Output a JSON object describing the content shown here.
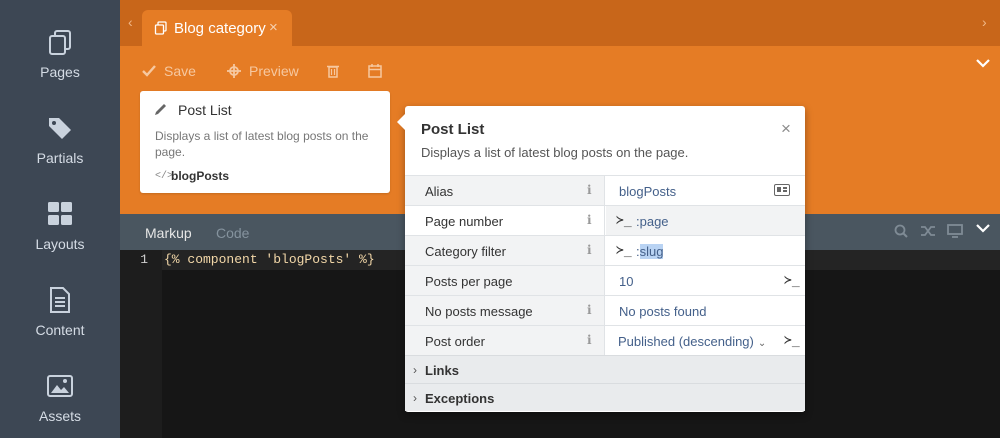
{
  "sidebar": {
    "items": [
      {
        "label": "Pages",
        "icon": "pages-icon"
      },
      {
        "label": "Partials",
        "icon": "partials-icon"
      },
      {
        "label": "Layouts",
        "icon": "layouts-icon"
      },
      {
        "label": "Content",
        "icon": "content-icon"
      },
      {
        "label": "Assets",
        "icon": "assets-icon"
      }
    ]
  },
  "header": {
    "tab": {
      "label": "Blog category",
      "close": "×"
    },
    "nav_left": "‹",
    "nav_right": "›",
    "toolbar": {
      "save_label": "Save",
      "preview_label": "Preview"
    },
    "collapse_icon": "⌄"
  },
  "component_card": {
    "title": "Post List",
    "description": "Displays a list of latest blog posts on the page.",
    "code_icon": "</>",
    "alias": "blogPosts"
  },
  "editor": {
    "tabs": [
      "Markup",
      "Code"
    ],
    "line_number": "1",
    "code": "{% component 'blogPosts' %}"
  },
  "inspector": {
    "title": "Post List",
    "description": "Displays a list of latest blog posts on the page.",
    "close": "×",
    "info_glyph": "i",
    "prompt_glyph": "≻_",
    "properties": [
      {
        "label": "Alias",
        "value": "blogPosts"
      },
      {
        "label": "Page number",
        "value": ":page"
      },
      {
        "label": "Category filter",
        "value_prefix": ":",
        "value_highlight": "slug"
      },
      {
        "label": "Posts per page",
        "value": "10"
      },
      {
        "label": "No posts message",
        "value": "No posts found"
      },
      {
        "label": "Post order",
        "value": "Published (descending)"
      }
    ],
    "groups": [
      "Links",
      "Exceptions"
    ]
  },
  "colors": {
    "accent_orange": "#e57c25",
    "tab_bar": "#c8661a",
    "sidebar_bg": "#3d4754",
    "value_text": "#44608a"
  }
}
